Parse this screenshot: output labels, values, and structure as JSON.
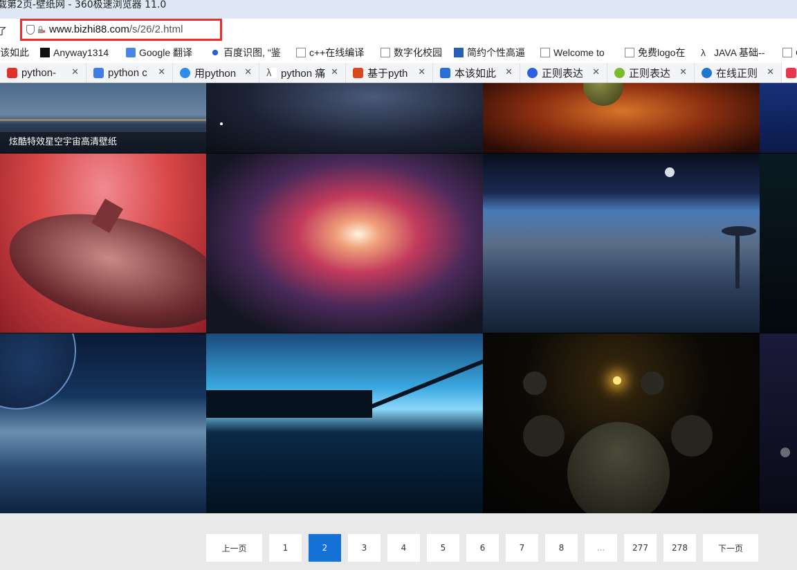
{
  "window": {
    "title": "载第2页-壁纸网 - 360极速浏览器 11.0"
  },
  "toolbar": {
    "back_glyph": "了"
  },
  "address_bar": {
    "host": "www.bizhi88.com",
    "path": "/s/26/2.html"
  },
  "bookmarks": [
    {
      "label": "该如此",
      "icon": "blank"
    },
    {
      "label": "Anyway1314",
      "icon": "anyway-logo-icon"
    },
    {
      "label": "Google 翻译",
      "icon": "google-translate-icon"
    },
    {
      "label": "百度识图, \"鉴",
      "icon": "baidu-paw-icon"
    },
    {
      "label": "c++在线编译",
      "icon": "page-icon"
    },
    {
      "label": "数字化校园",
      "icon": "page-icon"
    },
    {
      "label": "简约个性高逼",
      "icon": "site-icon"
    },
    {
      "label": "Welcome to",
      "icon": "page-icon"
    },
    {
      "label": "免费logo在",
      "icon": "page-icon"
    },
    {
      "label": "JAVA 基础--",
      "icon": "lambda-icon"
    },
    {
      "label": "C",
      "icon": "page-icon"
    }
  ],
  "tabs": [
    {
      "label": "python-",
      "icon": "csdn-icon",
      "color": "#e0312b"
    },
    {
      "label": "python c",
      "icon": "edit-icon",
      "color": "#3f7ee8"
    },
    {
      "label": "用python",
      "icon": "cloud-icon",
      "color": "#2e8de8"
    },
    {
      "label": "python 痛",
      "icon": "lambda-icon",
      "color": "#555555"
    },
    {
      "label": "基于pyth",
      "icon": "b-logo-icon",
      "color": "#d84a1b"
    },
    {
      "label": "本该如此",
      "icon": "bird-icon",
      "color": "#2a6fd6"
    },
    {
      "label": "正则表达",
      "icon": "baidu-paw-icon",
      "color": "#2a5fe0"
    },
    {
      "label": "正则表达",
      "icon": "android-icon",
      "color": "#7cbc2a"
    },
    {
      "label": "在线正则",
      "icon": "c-logo-icon",
      "color": "#1f77d0"
    },
    {
      "label": "",
      "icon": "360-icon",
      "color": "#e8364a"
    }
  ],
  "gallery": {
    "caption": "炫酷特效星空宇宙高清壁纸",
    "images": [
      "lake-sunset-wallpaper",
      "starfield-wallpaper",
      "orange-nebula-planet-wallpaper",
      "blue-space-wallpaper",
      "spaceship-red-wallpaper",
      "spiral-galaxy-wallpaper",
      "planet-horizon-city-wallpaper",
      "dark-starfield-wallpaper",
      "cloud-planet-wallpaper",
      "neon-city-bridge-wallpaper",
      "planets-sun-wallpaper",
      "moon-planets-wallpaper"
    ]
  },
  "pagination": {
    "prev": "上一页",
    "pages": [
      "1",
      "2",
      "3",
      "4",
      "5",
      "6",
      "7",
      "8",
      "...",
      "277",
      "278"
    ],
    "current": "2",
    "next": "下一页"
  }
}
